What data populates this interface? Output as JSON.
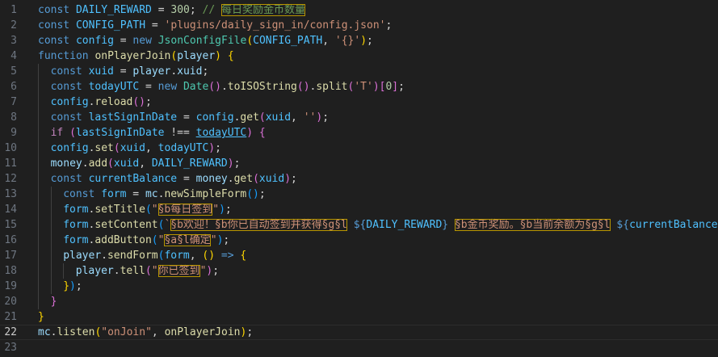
{
  "editor": {
    "current_line": 22,
    "lines": [
      {
        "n": "1",
        "indent": 0,
        "tokens": [
          {
            "t": "const ",
            "c": "kw"
          },
          {
            "t": "DAILY_REWARD",
            "c": "cst"
          },
          {
            "t": " = ",
            "c": "op"
          },
          {
            "t": "300",
            "c": "num"
          },
          {
            "t": "; ",
            "c": "op"
          },
          {
            "t": "// ",
            "c": "cmt"
          },
          {
            "t": "每日奖励金币数量",
            "c": "cmt",
            "h": 1
          }
        ]
      },
      {
        "n": "2",
        "indent": 0,
        "tokens": [
          {
            "t": "const ",
            "c": "kw"
          },
          {
            "t": "CONFIG_PATH",
            "c": "cst"
          },
          {
            "t": " = ",
            "c": "op"
          },
          {
            "t": "'plugins/daily_sign_in/config.json'",
            "c": "str"
          },
          {
            "t": ";",
            "c": "op"
          }
        ]
      },
      {
        "n": "3",
        "indent": 0,
        "tokens": [
          {
            "t": "const ",
            "c": "kw"
          },
          {
            "t": "config",
            "c": "cst"
          },
          {
            "t": " = ",
            "c": "op"
          },
          {
            "t": "new ",
            "c": "kw"
          },
          {
            "t": "JsonConfigFile",
            "c": "cls"
          },
          {
            "t": "(",
            "c": "b1"
          },
          {
            "t": "CONFIG_PATH",
            "c": "cst"
          },
          {
            "t": ", ",
            "c": "op"
          },
          {
            "t": "'{}'",
            "c": "str"
          },
          {
            "t": ")",
            "c": "b1"
          },
          {
            "t": ";",
            "c": "op"
          }
        ]
      },
      {
        "n": "4",
        "indent": 0,
        "tokens": [
          {
            "t": "function ",
            "c": "kw"
          },
          {
            "t": "onPlayerJoin",
            "c": "fn"
          },
          {
            "t": "(",
            "c": "b1"
          },
          {
            "t": "player",
            "c": "var"
          },
          {
            "t": ") ",
            "c": "b1"
          },
          {
            "t": "{",
            "c": "b1"
          }
        ]
      },
      {
        "n": "5",
        "indent": 1,
        "tokens": [
          {
            "t": "const ",
            "c": "kw"
          },
          {
            "t": "xuid",
            "c": "cst"
          },
          {
            "t": " = ",
            "c": "op"
          },
          {
            "t": "player",
            "c": "var"
          },
          {
            "t": ".",
            "c": "op"
          },
          {
            "t": "xuid",
            "c": "var"
          },
          {
            "t": ";",
            "c": "op"
          }
        ]
      },
      {
        "n": "6",
        "indent": 1,
        "tokens": [
          {
            "t": "const ",
            "c": "kw"
          },
          {
            "t": "todayUTC",
            "c": "cst"
          },
          {
            "t": " = ",
            "c": "op"
          },
          {
            "t": "new ",
            "c": "kw"
          },
          {
            "t": "Date",
            "c": "cls"
          },
          {
            "t": "()",
            "c": "b2"
          },
          {
            "t": ".",
            "c": "op"
          },
          {
            "t": "toISOString",
            "c": "fn"
          },
          {
            "t": "()",
            "c": "b2"
          },
          {
            "t": ".",
            "c": "op"
          },
          {
            "t": "split",
            "c": "fn"
          },
          {
            "t": "(",
            "c": "b2"
          },
          {
            "t": "'T'",
            "c": "str"
          },
          {
            "t": ")",
            "c": "b2"
          },
          {
            "t": "[",
            "c": "b2"
          },
          {
            "t": "0",
            "c": "num"
          },
          {
            "t": "]",
            "c": "b2"
          },
          {
            "t": ";",
            "c": "op"
          }
        ]
      },
      {
        "n": "7",
        "indent": 1,
        "tokens": [
          {
            "t": "config",
            "c": "cst"
          },
          {
            "t": ".",
            "c": "op"
          },
          {
            "t": "reload",
            "c": "fn"
          },
          {
            "t": "()",
            "c": "b2"
          },
          {
            "t": ";",
            "c": "op"
          }
        ]
      },
      {
        "n": "8",
        "indent": 1,
        "tokens": [
          {
            "t": "const ",
            "c": "kw"
          },
          {
            "t": "lastSignInDate",
            "c": "cst"
          },
          {
            "t": " = ",
            "c": "op"
          },
          {
            "t": "config",
            "c": "cst"
          },
          {
            "t": ".",
            "c": "op"
          },
          {
            "t": "get",
            "c": "fn"
          },
          {
            "t": "(",
            "c": "b2"
          },
          {
            "t": "xuid",
            "c": "cst"
          },
          {
            "t": ", ",
            "c": "op"
          },
          {
            "t": "''",
            "c": "str"
          },
          {
            "t": ")",
            "c": "b2"
          },
          {
            "t": ";",
            "c": "op"
          }
        ]
      },
      {
        "n": "9",
        "indent": 1,
        "tokens": [
          {
            "t": "if ",
            "c": "ctl"
          },
          {
            "t": "(",
            "c": "b2"
          },
          {
            "t": "lastSignInDate",
            "c": "cst"
          },
          {
            "t": " !== ",
            "c": "op"
          },
          {
            "t": "todayUTC",
            "c": "cst",
            "u": 1
          },
          {
            "t": ") ",
            "c": "b2"
          },
          {
            "t": "{",
            "c": "b2"
          }
        ]
      },
      {
        "n": "10",
        "indent": 1,
        "tokens": [
          {
            "t": "config",
            "c": "cst"
          },
          {
            "t": ".",
            "c": "op"
          },
          {
            "t": "set",
            "c": "fn"
          },
          {
            "t": "(",
            "c": "b2"
          },
          {
            "t": "xuid",
            "c": "cst"
          },
          {
            "t": ", ",
            "c": "op"
          },
          {
            "t": "todayUTC",
            "c": "cst"
          },
          {
            "t": ")",
            "c": "b2"
          },
          {
            "t": ";",
            "c": "op"
          }
        ]
      },
      {
        "n": "11",
        "indent": 1,
        "tokens": [
          {
            "t": "money",
            "c": "var"
          },
          {
            "t": ".",
            "c": "op"
          },
          {
            "t": "add",
            "c": "fn"
          },
          {
            "t": "(",
            "c": "b2"
          },
          {
            "t": "xuid",
            "c": "cst"
          },
          {
            "t": ", ",
            "c": "op"
          },
          {
            "t": "DAILY_REWARD",
            "c": "cst"
          },
          {
            "t": ")",
            "c": "b2"
          },
          {
            "t": ";",
            "c": "op"
          }
        ]
      },
      {
        "n": "12",
        "indent": 1,
        "tokens": [
          {
            "t": "const ",
            "c": "kw"
          },
          {
            "t": "currentBalance",
            "c": "cst"
          },
          {
            "t": " = ",
            "c": "op"
          },
          {
            "t": "money",
            "c": "var"
          },
          {
            "t": ".",
            "c": "op"
          },
          {
            "t": "get",
            "c": "fn"
          },
          {
            "t": "(",
            "c": "b2"
          },
          {
            "t": "xuid",
            "c": "cst"
          },
          {
            "t": ")",
            "c": "b2"
          },
          {
            "t": ";",
            "c": "op"
          }
        ]
      },
      {
        "n": "13",
        "indent": 2,
        "tokens": [
          {
            "t": "const ",
            "c": "kw"
          },
          {
            "t": "form",
            "c": "cst"
          },
          {
            "t": " = ",
            "c": "op"
          },
          {
            "t": "mc",
            "c": "var"
          },
          {
            "t": ".",
            "c": "op"
          },
          {
            "t": "newSimpleForm",
            "c": "fn"
          },
          {
            "t": "()",
            "c": "b3"
          },
          {
            "t": ";",
            "c": "op"
          }
        ]
      },
      {
        "n": "14",
        "indent": 2,
        "tokens": [
          {
            "t": "form",
            "c": "cst"
          },
          {
            "t": ".",
            "c": "op"
          },
          {
            "t": "setTitle",
            "c": "fn"
          },
          {
            "t": "(",
            "c": "b3"
          },
          {
            "t": "\"",
            "c": "str"
          },
          {
            "t": "§b每日签到",
            "c": "str",
            "h": 1
          },
          {
            "t": "\"",
            "c": "str"
          },
          {
            "t": ")",
            "c": "b3"
          },
          {
            "t": ";",
            "c": "op"
          }
        ]
      },
      {
        "n": "15",
        "indent": 2,
        "tokens": [
          {
            "t": "form",
            "c": "cst"
          },
          {
            "t": ".",
            "c": "op"
          },
          {
            "t": "setContent",
            "c": "fn"
          },
          {
            "t": "(",
            "c": "b3"
          },
          {
            "t": "`",
            "c": "str"
          },
          {
            "t": "§b欢迎！§b你已自动签到并获得§g§l",
            "c": "str",
            "h": 1
          },
          {
            "t": " ",
            "c": "str"
          },
          {
            "t": "${",
            "c": "tmpl"
          },
          {
            "t": "DAILY_REWARD",
            "c": "cst"
          },
          {
            "t": "}",
            "c": "tmpl"
          },
          {
            "t": " ",
            "c": "str"
          },
          {
            "t": "§b金币奖励。§b当前余额为§g§l",
            "c": "str",
            "h": 1
          },
          {
            "t": " ",
            "c": "str"
          },
          {
            "t": "${",
            "c": "tmpl"
          },
          {
            "t": "currentBalance",
            "c": "cst"
          },
          {
            "t": "}",
            "c": "tmpl"
          },
          {
            "t": "`",
            "c": "str"
          },
          {
            "t": ")",
            "c": "b3"
          },
          {
            "t": ";",
            "c": "op"
          }
        ]
      },
      {
        "n": "16",
        "indent": 2,
        "tokens": [
          {
            "t": "form",
            "c": "cst"
          },
          {
            "t": ".",
            "c": "op"
          },
          {
            "t": "addButton",
            "c": "fn"
          },
          {
            "t": "(",
            "c": "b3"
          },
          {
            "t": "\"",
            "c": "str"
          },
          {
            "t": "§a§l确定",
            "c": "str",
            "h": 1
          },
          {
            "t": "\"",
            "c": "str"
          },
          {
            "t": ")",
            "c": "b3"
          },
          {
            "t": ";",
            "c": "op"
          }
        ]
      },
      {
        "n": "17",
        "indent": 2,
        "tokens": [
          {
            "t": "player",
            "c": "var"
          },
          {
            "t": ".",
            "c": "op"
          },
          {
            "t": "sendForm",
            "c": "fn"
          },
          {
            "t": "(",
            "c": "b3"
          },
          {
            "t": "form",
            "c": "cst"
          },
          {
            "t": ", ",
            "c": "op"
          },
          {
            "t": "()",
            "c": "b1"
          },
          {
            "t": " => ",
            "c": "kw"
          },
          {
            "t": "{",
            "c": "b1"
          }
        ]
      },
      {
        "n": "18",
        "indent": 3,
        "tokens": [
          {
            "t": "player",
            "c": "var"
          },
          {
            "t": ".",
            "c": "op"
          },
          {
            "t": "tell",
            "c": "fn"
          },
          {
            "t": "(",
            "c": "b2"
          },
          {
            "t": "\"",
            "c": "str"
          },
          {
            "t": "你已签到",
            "c": "str",
            "h": 1
          },
          {
            "t": "\"",
            "c": "str"
          },
          {
            "t": ")",
            "c": "b2"
          },
          {
            "t": ";",
            "c": "op"
          }
        ]
      },
      {
        "n": "19",
        "indent": 2,
        "tokens": [
          {
            "t": "}",
            "c": "b1"
          },
          {
            "t": ")",
            "c": "b3"
          },
          {
            "t": ";",
            "c": "op"
          }
        ]
      },
      {
        "n": "20",
        "indent": 1,
        "tokens": [
          {
            "t": "}",
            "c": "b2"
          }
        ]
      },
      {
        "n": "21",
        "indent": 0,
        "tokens": [
          {
            "t": "}",
            "c": "b1"
          }
        ]
      },
      {
        "n": "22",
        "indent": 0,
        "tokens": [
          {
            "t": "mc",
            "c": "var"
          },
          {
            "t": ".",
            "c": "op"
          },
          {
            "t": "listen",
            "c": "fn"
          },
          {
            "t": "(",
            "c": "b1"
          },
          {
            "t": "\"onJoin\"",
            "c": "str"
          },
          {
            "t": ", ",
            "c": "op"
          },
          {
            "t": "onPlayerJoin",
            "c": "fn"
          },
          {
            "t": ")",
            "c": "b1"
          },
          {
            "t": ";",
            "c": "op"
          }
        ]
      },
      {
        "n": "23",
        "indent": 0,
        "tokens": []
      }
    ]
  }
}
